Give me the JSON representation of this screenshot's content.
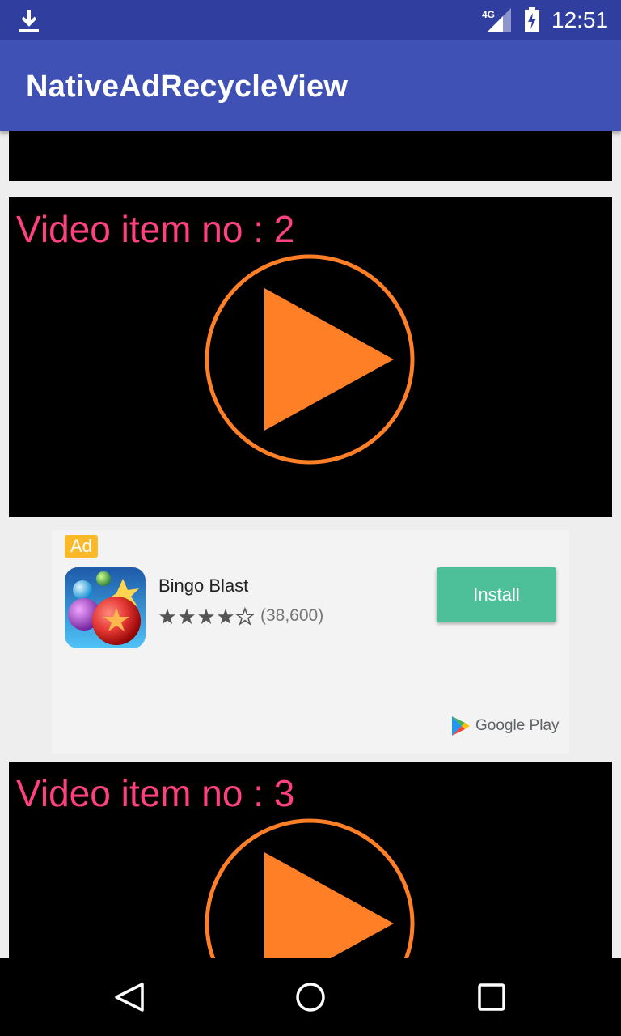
{
  "status_bar": {
    "network": "4G",
    "time": "12:51",
    "icons": [
      "download-icon",
      "signal-icon",
      "battery-charging-icon"
    ]
  },
  "app_bar": {
    "title": "NativeAdRecycleView"
  },
  "videos": [
    {
      "title": ""
    },
    {
      "title": "Video item no : 2"
    },
    {
      "title": "Video item no : 3"
    }
  ],
  "ad": {
    "badge": "Ad",
    "app_name": "Bingo Blast",
    "rating": 4.5,
    "review_count": "(38,600)",
    "cta": "Install",
    "store": "Google Play",
    "icon": "bingo-blast-app-icon"
  },
  "colors": {
    "status_bar": "#303F9F",
    "app_bar": "#3F51B5",
    "video_title": "#FF4081",
    "play_icon": "#FF7F27",
    "ad_badge": "#FBB829",
    "install_button": "#4DBF99"
  },
  "nav_bar": {
    "icons": [
      "back-icon",
      "home-icon",
      "recents-icon"
    ]
  }
}
